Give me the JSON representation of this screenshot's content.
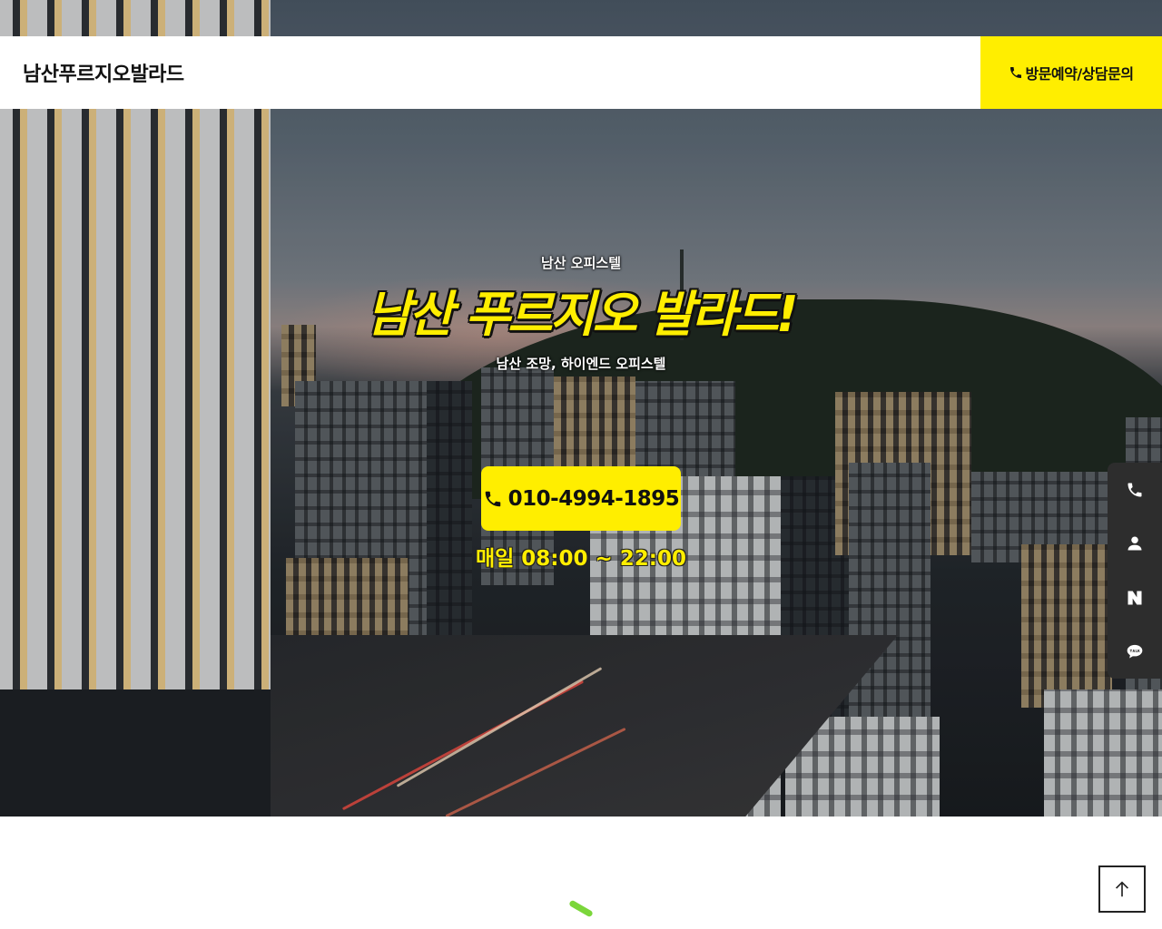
{
  "header": {
    "logo": "남산푸르지오발라드",
    "reserve_label": "방문예약/상담문의",
    "reserve_icon": "phone-icon"
  },
  "hero": {
    "eyebrow": "남산 오피스텔",
    "title": "남산 푸르지오 발라드!",
    "description": "남산 조망, 하이엔드 오피스텔",
    "phone_number": "010-4994-1895",
    "phone_icon": "phone-icon",
    "hours": "매일 08:00 ~ 22:00"
  },
  "quick_menu": {
    "items": [
      {
        "icon": "phone-icon"
      },
      {
        "icon": "user-icon"
      },
      {
        "icon": "naver-icon"
      },
      {
        "icon": "kakaotalk-icon"
      }
    ]
  },
  "scroll_top": {
    "icon": "arrow-up-icon"
  },
  "colors": {
    "accent": "#ffee00",
    "header_bg": "#ffffff",
    "quick_menu_bg": "#2d2d2d",
    "loader": "#7bd63b"
  }
}
